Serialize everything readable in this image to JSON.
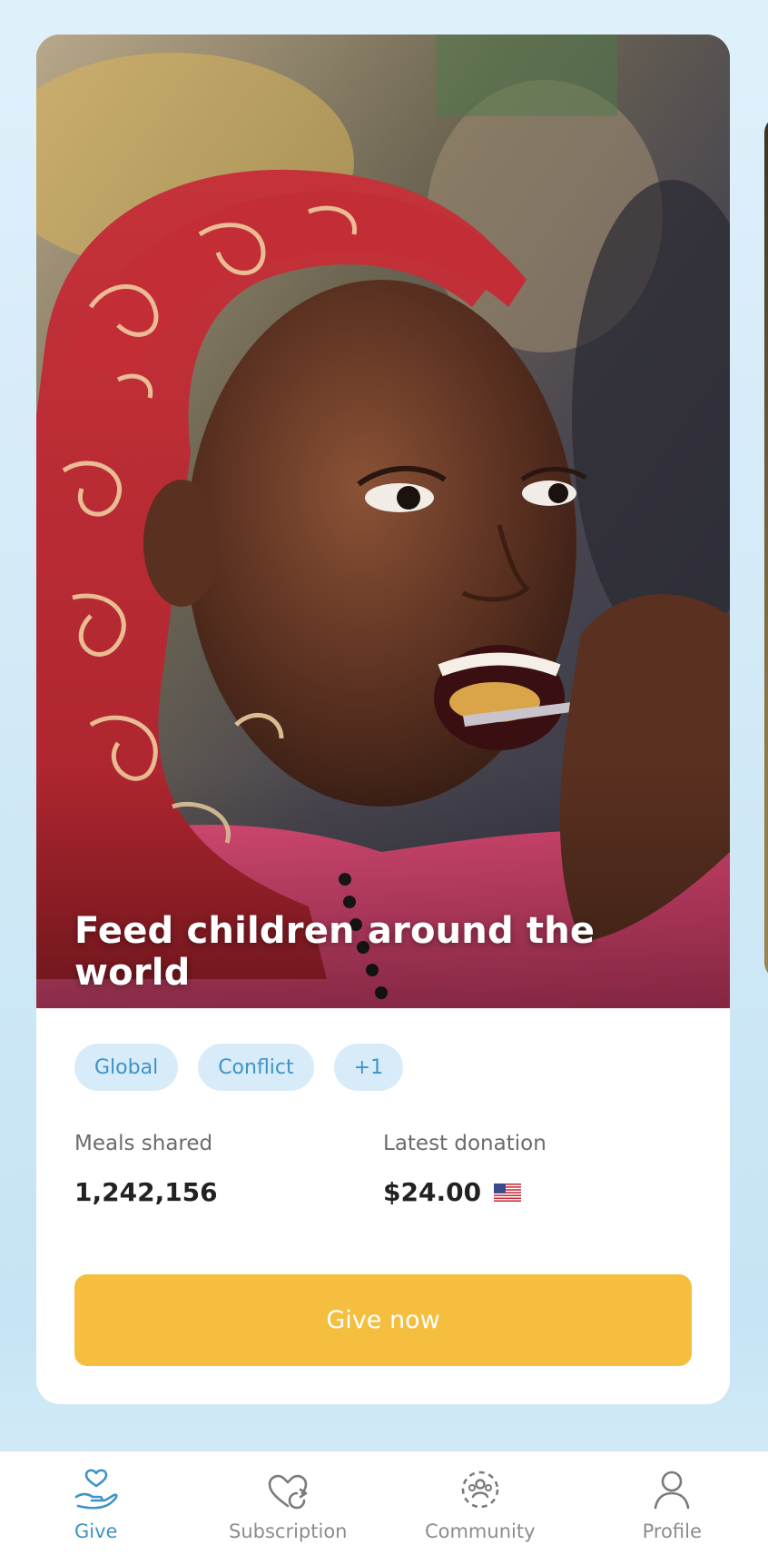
{
  "hero": {
    "title": "Feed children around the world"
  },
  "tags": [
    "Global",
    "Conflict",
    "+1"
  ],
  "stats": {
    "meals_label": "Meals shared",
    "meals_value": "1,242,156",
    "donation_label": "Latest donation",
    "donation_value": "$24.00",
    "donation_flag": "us-flag-icon"
  },
  "cta": {
    "label": "Give now"
  },
  "tabbar": {
    "items": [
      {
        "label": "Give",
        "icon": "heart-hand-icon",
        "active": true
      },
      {
        "label": "Subscription",
        "icon": "heart-refresh-icon",
        "active": false
      },
      {
        "label": "Community",
        "icon": "community-icon",
        "active": false
      },
      {
        "label": "Profile",
        "icon": "person-icon",
        "active": false
      }
    ]
  },
  "colors": {
    "accent_blue": "#3e93c7",
    "cta_yellow": "#f5be3f",
    "tag_bg": "#d7ecf8",
    "background": "#d3eaf7"
  }
}
